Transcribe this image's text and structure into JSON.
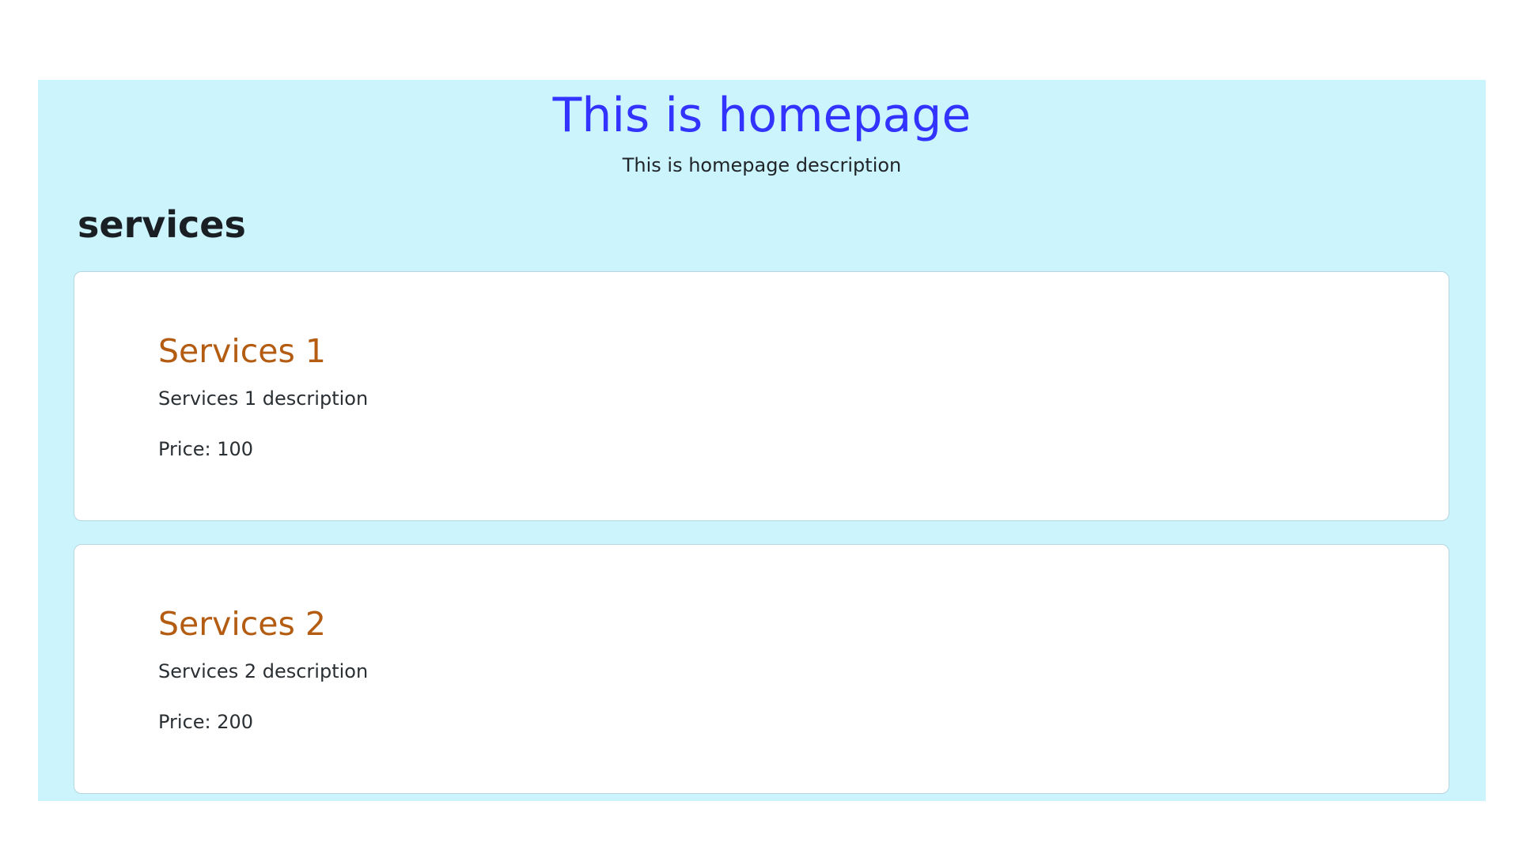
{
  "hero": {
    "title": "This is homepage",
    "description": "This is homepage description"
  },
  "services_section": {
    "heading": "services",
    "items": [
      {
        "title": "Services 1",
        "description": "Services 1 description",
        "price_text": "Price: 100"
      },
      {
        "title": "Services 2",
        "description": "Services 2 description",
        "price_text": "Price: 200"
      }
    ]
  },
  "colors": {
    "background": "#cbf4fd",
    "hero_title": "#3333ff",
    "card_title": "#b35c12",
    "card_background": "#ffffff"
  }
}
